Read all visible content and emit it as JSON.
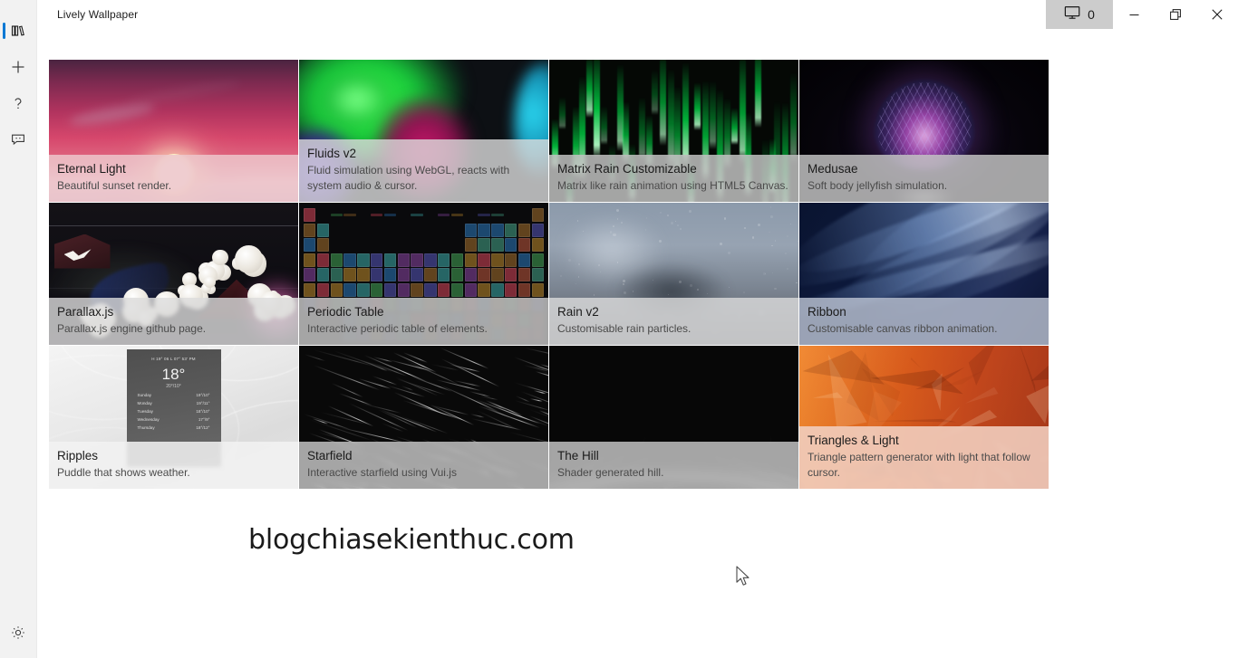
{
  "window": {
    "title": "Lively Wallpaper",
    "screen_count": "0",
    "screen_icon": "monitor-icon",
    "minimize_label": "Minimize",
    "restore_label": "Restore",
    "close_label": "Close"
  },
  "sidebar": {
    "items": [
      {
        "icon": "library-icon",
        "label": "Library",
        "active": true
      },
      {
        "icon": "plus-icon",
        "label": "Add Wallpaper",
        "active": false
      },
      {
        "icon": "help-icon",
        "label": "Help",
        "active": false
      },
      {
        "icon": "feedback-icon",
        "label": "Feedback",
        "active": false
      }
    ],
    "bottom": {
      "icon": "gear-icon",
      "label": "Settings"
    }
  },
  "watermark": "blogchiasekienthuc.com",
  "library": {
    "wallpapers": [
      {
        "name": "Eternal Light",
        "desc": "Beautiful sunset render."
      },
      {
        "name": "Fluids v2",
        "desc": "Fluid simulation using WebGL, reacts with system audio & cursor."
      },
      {
        "name": "Matrix Rain Customizable",
        "desc": "Matrix like rain animation using HTML5 Canvas."
      },
      {
        "name": "Medusae",
        "desc": "Soft body jellyfish simulation."
      },
      {
        "name": "Parallax.js",
        "desc": "Parallax.js engine github page."
      },
      {
        "name": "Periodic Table",
        "desc": "Interactive periodic table of elements."
      },
      {
        "name": "Rain v2",
        "desc": "Customisable rain particles."
      },
      {
        "name": "Ribbon",
        "desc": "Customisable canvas ribbon animation."
      },
      {
        "name": "Ripples",
        "desc": "Puddle that shows weather."
      },
      {
        "name": "Starfield",
        "desc": "Interactive starfield using Vui.js"
      },
      {
        "name": "The Hill",
        "desc": "Shader generated hill."
      },
      {
        "name": "Triangles & Light",
        "desc": "Triangle pattern generator with light that follow cursor."
      }
    ]
  },
  "ripples_widget": {
    "top_line": "H 19° 06 L 07° 53' PM",
    "temperature": "18°",
    "high_low": "20°/10°",
    "forecast": [
      {
        "day": "Sunday",
        "range": "19°/10°"
      },
      {
        "day": "Monday",
        "range": "19°/11°"
      },
      {
        "day": "Tuesday",
        "range": "18°/10°"
      },
      {
        "day": "Wednesday",
        "range": "17°/9°"
      },
      {
        "day": "Thursday",
        "range": "18°/12°"
      }
    ]
  },
  "colors": {
    "accent": "#0078d4",
    "rail_bg": "#f2f2f2",
    "caption_bg": "#cdcdcd",
    "screen_btn_bg": "#cccccc"
  }
}
